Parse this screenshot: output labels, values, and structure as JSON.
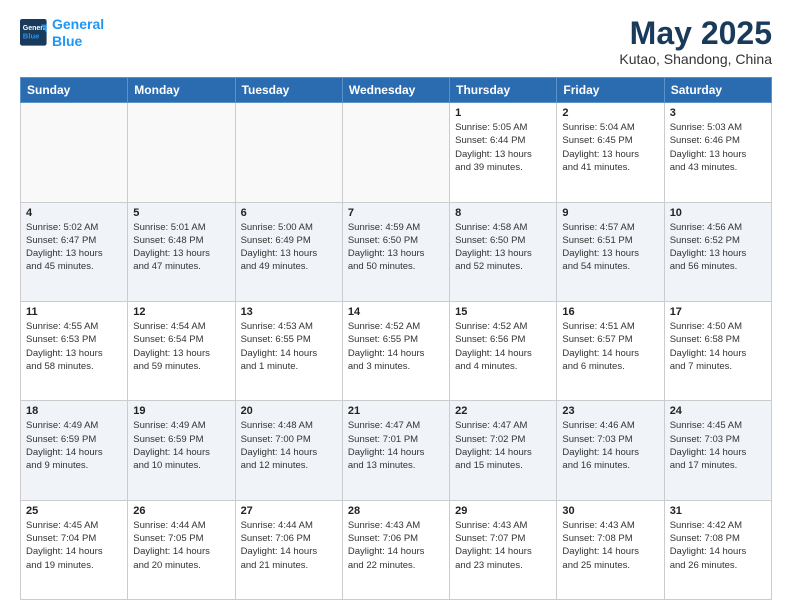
{
  "logo": {
    "line1": "General",
    "line2": "Blue"
  },
  "title": "May 2025",
  "location": "Kutao, Shandong, China",
  "days_of_week": [
    "Sunday",
    "Monday",
    "Tuesday",
    "Wednesday",
    "Thursday",
    "Friday",
    "Saturday"
  ],
  "weeks": [
    [
      {
        "day": "",
        "info": ""
      },
      {
        "day": "",
        "info": ""
      },
      {
        "day": "",
        "info": ""
      },
      {
        "day": "",
        "info": ""
      },
      {
        "day": "1",
        "info": "Sunrise: 5:05 AM\nSunset: 6:44 PM\nDaylight: 13 hours\nand 39 minutes."
      },
      {
        "day": "2",
        "info": "Sunrise: 5:04 AM\nSunset: 6:45 PM\nDaylight: 13 hours\nand 41 minutes."
      },
      {
        "day": "3",
        "info": "Sunrise: 5:03 AM\nSunset: 6:46 PM\nDaylight: 13 hours\nand 43 minutes."
      }
    ],
    [
      {
        "day": "4",
        "info": "Sunrise: 5:02 AM\nSunset: 6:47 PM\nDaylight: 13 hours\nand 45 minutes."
      },
      {
        "day": "5",
        "info": "Sunrise: 5:01 AM\nSunset: 6:48 PM\nDaylight: 13 hours\nand 47 minutes."
      },
      {
        "day": "6",
        "info": "Sunrise: 5:00 AM\nSunset: 6:49 PM\nDaylight: 13 hours\nand 49 minutes."
      },
      {
        "day": "7",
        "info": "Sunrise: 4:59 AM\nSunset: 6:50 PM\nDaylight: 13 hours\nand 50 minutes."
      },
      {
        "day": "8",
        "info": "Sunrise: 4:58 AM\nSunset: 6:50 PM\nDaylight: 13 hours\nand 52 minutes."
      },
      {
        "day": "9",
        "info": "Sunrise: 4:57 AM\nSunset: 6:51 PM\nDaylight: 13 hours\nand 54 minutes."
      },
      {
        "day": "10",
        "info": "Sunrise: 4:56 AM\nSunset: 6:52 PM\nDaylight: 13 hours\nand 56 minutes."
      }
    ],
    [
      {
        "day": "11",
        "info": "Sunrise: 4:55 AM\nSunset: 6:53 PM\nDaylight: 13 hours\nand 58 minutes."
      },
      {
        "day": "12",
        "info": "Sunrise: 4:54 AM\nSunset: 6:54 PM\nDaylight: 13 hours\nand 59 minutes."
      },
      {
        "day": "13",
        "info": "Sunrise: 4:53 AM\nSunset: 6:55 PM\nDaylight: 14 hours\nand 1 minute."
      },
      {
        "day": "14",
        "info": "Sunrise: 4:52 AM\nSunset: 6:55 PM\nDaylight: 14 hours\nand 3 minutes."
      },
      {
        "day": "15",
        "info": "Sunrise: 4:52 AM\nSunset: 6:56 PM\nDaylight: 14 hours\nand 4 minutes."
      },
      {
        "day": "16",
        "info": "Sunrise: 4:51 AM\nSunset: 6:57 PM\nDaylight: 14 hours\nand 6 minutes."
      },
      {
        "day": "17",
        "info": "Sunrise: 4:50 AM\nSunset: 6:58 PM\nDaylight: 14 hours\nand 7 minutes."
      }
    ],
    [
      {
        "day": "18",
        "info": "Sunrise: 4:49 AM\nSunset: 6:59 PM\nDaylight: 14 hours\nand 9 minutes."
      },
      {
        "day": "19",
        "info": "Sunrise: 4:49 AM\nSunset: 6:59 PM\nDaylight: 14 hours\nand 10 minutes."
      },
      {
        "day": "20",
        "info": "Sunrise: 4:48 AM\nSunset: 7:00 PM\nDaylight: 14 hours\nand 12 minutes."
      },
      {
        "day": "21",
        "info": "Sunrise: 4:47 AM\nSunset: 7:01 PM\nDaylight: 14 hours\nand 13 minutes."
      },
      {
        "day": "22",
        "info": "Sunrise: 4:47 AM\nSunset: 7:02 PM\nDaylight: 14 hours\nand 15 minutes."
      },
      {
        "day": "23",
        "info": "Sunrise: 4:46 AM\nSunset: 7:03 PM\nDaylight: 14 hours\nand 16 minutes."
      },
      {
        "day": "24",
        "info": "Sunrise: 4:45 AM\nSunset: 7:03 PM\nDaylight: 14 hours\nand 17 minutes."
      }
    ],
    [
      {
        "day": "25",
        "info": "Sunrise: 4:45 AM\nSunset: 7:04 PM\nDaylight: 14 hours\nand 19 minutes."
      },
      {
        "day": "26",
        "info": "Sunrise: 4:44 AM\nSunset: 7:05 PM\nDaylight: 14 hours\nand 20 minutes."
      },
      {
        "day": "27",
        "info": "Sunrise: 4:44 AM\nSunset: 7:06 PM\nDaylight: 14 hours\nand 21 minutes."
      },
      {
        "day": "28",
        "info": "Sunrise: 4:43 AM\nSunset: 7:06 PM\nDaylight: 14 hours\nand 22 minutes."
      },
      {
        "day": "29",
        "info": "Sunrise: 4:43 AM\nSunset: 7:07 PM\nDaylight: 14 hours\nand 23 minutes."
      },
      {
        "day": "30",
        "info": "Sunrise: 4:43 AM\nSunset: 7:08 PM\nDaylight: 14 hours\nand 25 minutes."
      },
      {
        "day": "31",
        "info": "Sunrise: 4:42 AM\nSunset: 7:08 PM\nDaylight: 14 hours\nand 26 minutes."
      }
    ]
  ]
}
